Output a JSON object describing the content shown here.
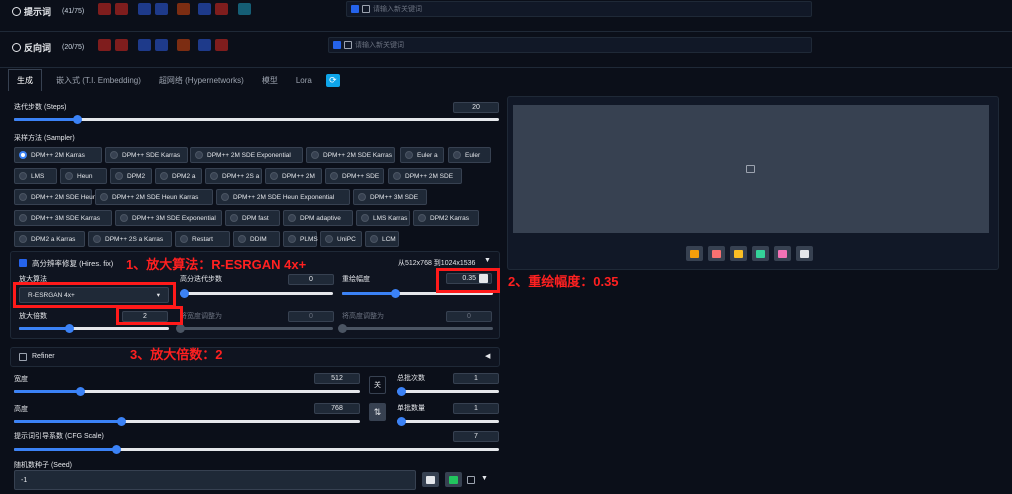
{
  "prompt": {
    "title": "提示词",
    "count": "(41/75)",
    "placeholder": "请输入新关键词"
  },
  "negative": {
    "title": "反向词",
    "count": "(20/75)",
    "placeholder": "请输入新关键词"
  },
  "tabs": [
    "生成",
    "嵌入式 (T.I. Embedding)",
    "超网络 (Hypernetworks)",
    "模型",
    "Lora"
  ],
  "steps": {
    "label": "迭代步数 (Steps)",
    "value": "20",
    "fraction": 0.13
  },
  "sampler": {
    "label": "采样方法 (Sampler)",
    "selected": "DPM++ 2M Karras",
    "rows": [
      [
        "DPM++ 2M Karras",
        "DPM++ SDE Karras",
        "DPM++ 2M SDE Exponential",
        "DPM++ 2M SDE Karras",
        "Euler a",
        "Euler"
      ],
      [
        "LMS",
        "Heun",
        "DPM2",
        "DPM2 a",
        "DPM++ 2S a",
        "DPM++ 2M",
        "DPM++ SDE",
        "DPM++ 2M SDE"
      ],
      [
        "DPM++ 2M SDE Heun",
        "DPM++ 2M SDE Heun Karras",
        "DPM++ 2M SDE Heun Exponential",
        "DPM++ 3M SDE"
      ],
      [
        "DPM++ 3M SDE Karras",
        "DPM++ 3M SDE Exponential",
        "DPM fast",
        "DPM adaptive",
        "LMS Karras",
        "DPM2 Karras"
      ],
      [
        "DPM2 a Karras",
        "DPM++ 2S a Karras",
        "Restart",
        "DDIM",
        "PLMS",
        "UniPC",
        "LCM"
      ]
    ]
  },
  "hires": {
    "label": "高分辨率修复 (Hires. fix)",
    "info": "从512x768 到1024x1536",
    "toggle": "▼",
    "upscaler_label": "放大算法",
    "upscaler_value": "R-ESRGAN 4x+",
    "hires_steps_label": "高分迭代步数",
    "hires_steps_value": "0",
    "hires_steps_fraction": 0.0,
    "denoise_label": "重绘幅度",
    "denoise_value": "0.35",
    "denoise_fraction": 0.35,
    "scale_label": "放大倍数",
    "scale_value": "2",
    "scale_fraction": 0.33,
    "width_to_label": "将宽度调整为",
    "width_to_value": "0",
    "height_to_label": "将高度调整为",
    "height_to_value": "0"
  },
  "refiner": {
    "label": "Refiner",
    "arrow": "◀"
  },
  "width": {
    "label": "宽度",
    "value": "512",
    "fraction": 0.19
  },
  "height": {
    "label": "高度",
    "value": "768",
    "fraction": 0.31
  },
  "swap_top": "关",
  "swap_icon": "⇅",
  "batch_count": {
    "label": "总批次数",
    "value": "1",
    "fraction": 0.0
  },
  "batch_size": {
    "label": "单批数量",
    "value": "1",
    "fraction": 0.0
  },
  "cfg": {
    "label": "提示词引导系数 (CFG Scale)",
    "value": "7",
    "fraction": 0.21
  },
  "seed": {
    "label": "随机数种子 (Seed)",
    "value": "-1"
  },
  "annotations": [
    "1、放大算法：R-ESRGAN 4x+",
    "2、重绘幅度：0.35",
    "3、放大倍数：2"
  ],
  "colors": {
    "accent": "#3b82f6",
    "annotation": "#ff1a1a",
    "background": "#0b0f19"
  }
}
